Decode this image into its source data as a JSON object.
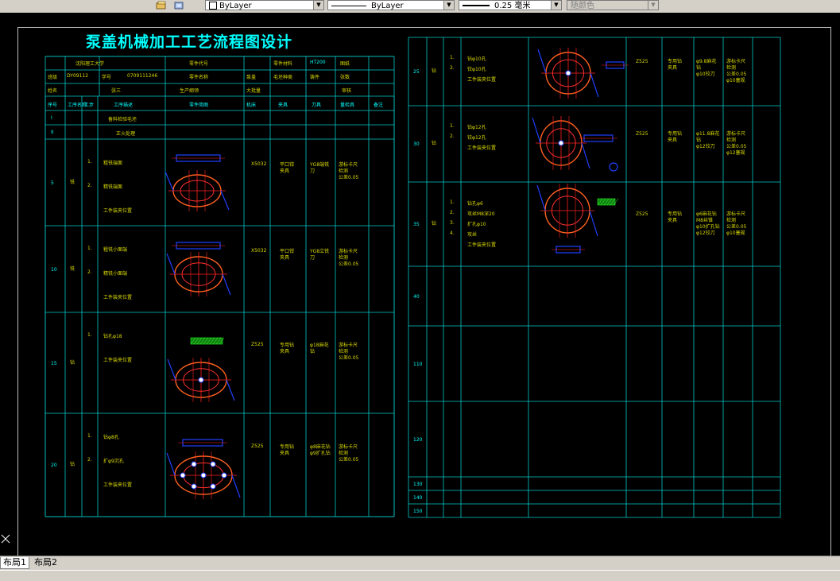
{
  "toolbar": {
    "color_combo": "ByLayer",
    "linetype_combo": "ByLayer",
    "lineweight_combo": "0.25 毫米",
    "plotstyle_combo": "随颜色"
  },
  "drawing": {
    "title": "泵盖机械加工工艺流程图设计",
    "header": {
      "school": "沈阳理工大学",
      "part_code_label": "零件代号",
      "material_label": "零件材料",
      "material": "HT200",
      "sheet_label": "图纸",
      "class_label": "班级",
      "class_value": "DY09112",
      "student_id_label": "学号",
      "student_id": "0709111246",
      "part_name_label": "零件名称",
      "part_name": "泵盖",
      "designer_label": "毛坯种类",
      "designer_value": "铸件",
      "pages_label": "张数",
      "name_label": "姓名",
      "name_value": "张三",
      "production_label": "生产纲领",
      "production_value": "大批量",
      "check_label": "审核"
    },
    "columns": [
      "序号",
      "工序名称",
      "工步",
      "工序描述",
      "零件简图",
      "机床",
      "夹具",
      "刀具",
      "量检具",
      "备注"
    ],
    "left_rows": [
      {
        "no": "I",
        "name": "",
        "desc": "备料检验毛坯"
      },
      {
        "no": "II",
        "name": "",
        "desc": "正火处理"
      },
      {
        "no": "5",
        "name": "铣",
        "steps": [
          "1.",
          "2.",
          ""
        ],
        "descs": [
          "粗铣端面",
          "精铣端面",
          "工件装夹位置"
        ],
        "machine": "X5032",
        "fixture": "平口钳\n夹具",
        "tool": "YG8端铣\n刀",
        "gauge": "游标卡尺\n检测\n公差0.05"
      },
      {
        "no": "10",
        "name": "铣",
        "steps": [
          "1.",
          "2.",
          ""
        ],
        "descs": [
          "粗铣小面端",
          "精铣小面端",
          "工件装夹位置"
        ],
        "machine": "X5032",
        "fixture": "平口钳\n夹具",
        "tool": "YG8立铣\n刀",
        "gauge": "游标卡尺\n检测\n公差0.05"
      },
      {
        "no": "15",
        "name": "钻",
        "steps": [
          "1.",
          ""
        ],
        "descs": [
          "钻孔φ18",
          "工件装夹位置"
        ],
        "machine": "Z525",
        "fixture": "专用钻\n夹具",
        "tool": "φ18麻花\n钻",
        "gauge": "游标卡尺\n检测\n公差0.05"
      },
      {
        "no": "20",
        "name": "钻",
        "steps": [
          "1.",
          "2.",
          ""
        ],
        "descs": [
          "钻φ8孔",
          "扩φ9沉孔",
          "工件装夹位置"
        ],
        "machine": "Z525",
        "fixture": "专用钻\n夹具",
        "tool": "φ8麻花钻\nφ9扩孔钻",
        "gauge": "游标卡尺\n检测\n公差0.05"
      }
    ],
    "right_rows": [
      {
        "no": "25",
        "name": "钻",
        "steps": [
          "1.",
          "2.",
          ""
        ],
        "descs": [
          "钻φ10孔",
          "铰φ10孔",
          "工件装夹位置"
        ],
        "machine": "Z525",
        "fixture": "专用钻\n夹具",
        "tool": "φ9.8麻花\n钻\nφ10铰刀",
        "gauge": "游标卡尺\n检测\n公差0.05\nφ10塞规"
      },
      {
        "no": "30",
        "name": "钻",
        "steps": [
          "1.",
          "2.",
          ""
        ],
        "descs": [
          "钻φ12孔",
          "铰φ12孔",
          "工件装夹位置"
        ],
        "machine": "Z525",
        "fixture": "专用钻\n夹具",
        "tool": "φ11.8麻花\n钻\nφ12铰刀",
        "gauge": "游标卡尺\n检测\n公差0.05\nφ12塞规"
      },
      {
        "no": "35",
        "name": "钻",
        "steps": [
          "1.",
          "2.",
          "3.",
          "4.",
          ""
        ],
        "descs": [
          "钻孔φ6",
          "攻丝M8深20",
          "扩孔φ10",
          "攻丝",
          "工件装夹位置"
        ],
        "machine": "Z525",
        "fixture": "专用钻\n夹具",
        "tool": "φ6麻花钻\nM8丝锥\nφ10扩孔钻\nφ12铰刀",
        "gauge": "游标卡尺\n检测\n公差0.05\nφ10塞规"
      },
      {
        "no": "40"
      },
      {
        "no": "110"
      },
      {
        "no": "120"
      },
      {
        "no": "130"
      },
      {
        "no": "140"
      },
      {
        "no": "150"
      }
    ]
  },
  "layout_tabs": [
    "布局1",
    "布局2"
  ]
}
